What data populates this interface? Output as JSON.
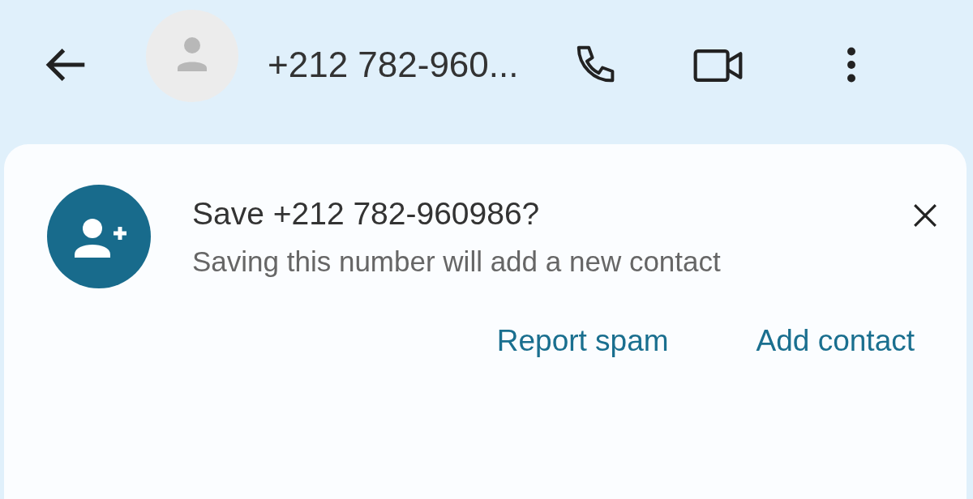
{
  "header": {
    "title": "+212 782-960..."
  },
  "prompt": {
    "title": "Save +212 782-960986?",
    "message": "Saving this number will add a new contact",
    "actions": [
      {
        "label": "Report spam"
      },
      {
        "label": "Add contact"
      }
    ]
  }
}
